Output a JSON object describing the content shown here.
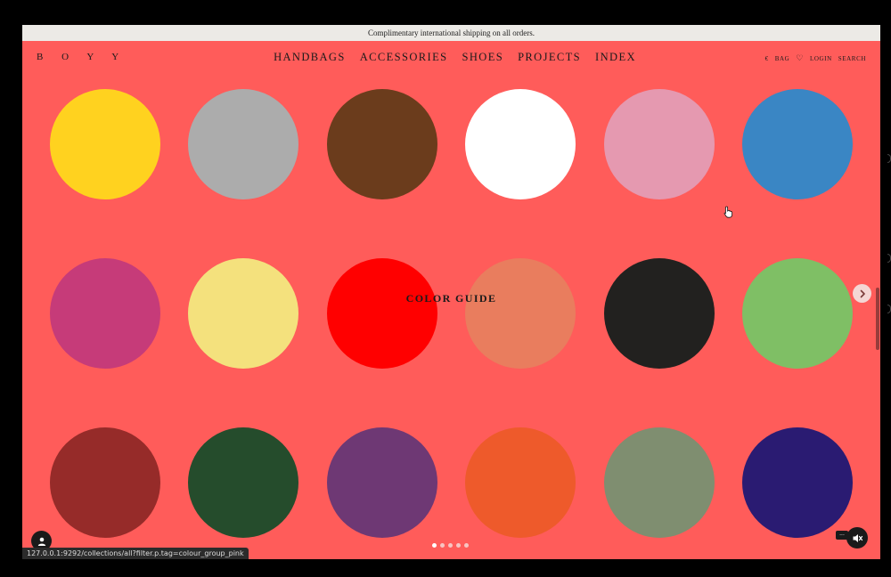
{
  "announcement": "Complimentary international shipping on all orders.",
  "logo": "B O Y Y",
  "nav": [
    "HANDBAGS",
    "ACCESSORIES",
    "SHOES",
    "PROJECTS",
    "INDEX"
  ],
  "utilities": {
    "currency": "€",
    "bag": "BAG",
    "login": "LOGIN",
    "search": "SEARCH",
    "wishlist_icon": "heart-icon"
  },
  "center_label": "COLOR GUIDE",
  "page_background": "#ff5c5a",
  "swatches": [
    {
      "color": "#ffd21f"
    },
    {
      "color": "#acacac"
    },
    {
      "color": "#6b3c1c"
    },
    {
      "color": "#ffffff"
    },
    {
      "color": "#e599b0"
    },
    {
      "color": "#3a86c4"
    },
    {
      "color": "#c63b79"
    },
    {
      "color": "#f4e17d"
    },
    {
      "color": "#ff0000"
    },
    {
      "color": "#e97d5e"
    },
    {
      "color": "#22211f"
    },
    {
      "color": "#7fbf65"
    },
    {
      "color": "#962b29"
    },
    {
      "color": "#254c2c"
    },
    {
      "color": "#6e3874"
    },
    {
      "color": "#ee5a2b"
    },
    {
      "color": "#7f8e70"
    },
    {
      "color": "#2a1b72"
    }
  ],
  "carousel": {
    "total_slides": 5,
    "active_slide": 1
  },
  "status_url": "127.0.0.1:9292/collections/all?filter.p.tag=colour_group_pink"
}
